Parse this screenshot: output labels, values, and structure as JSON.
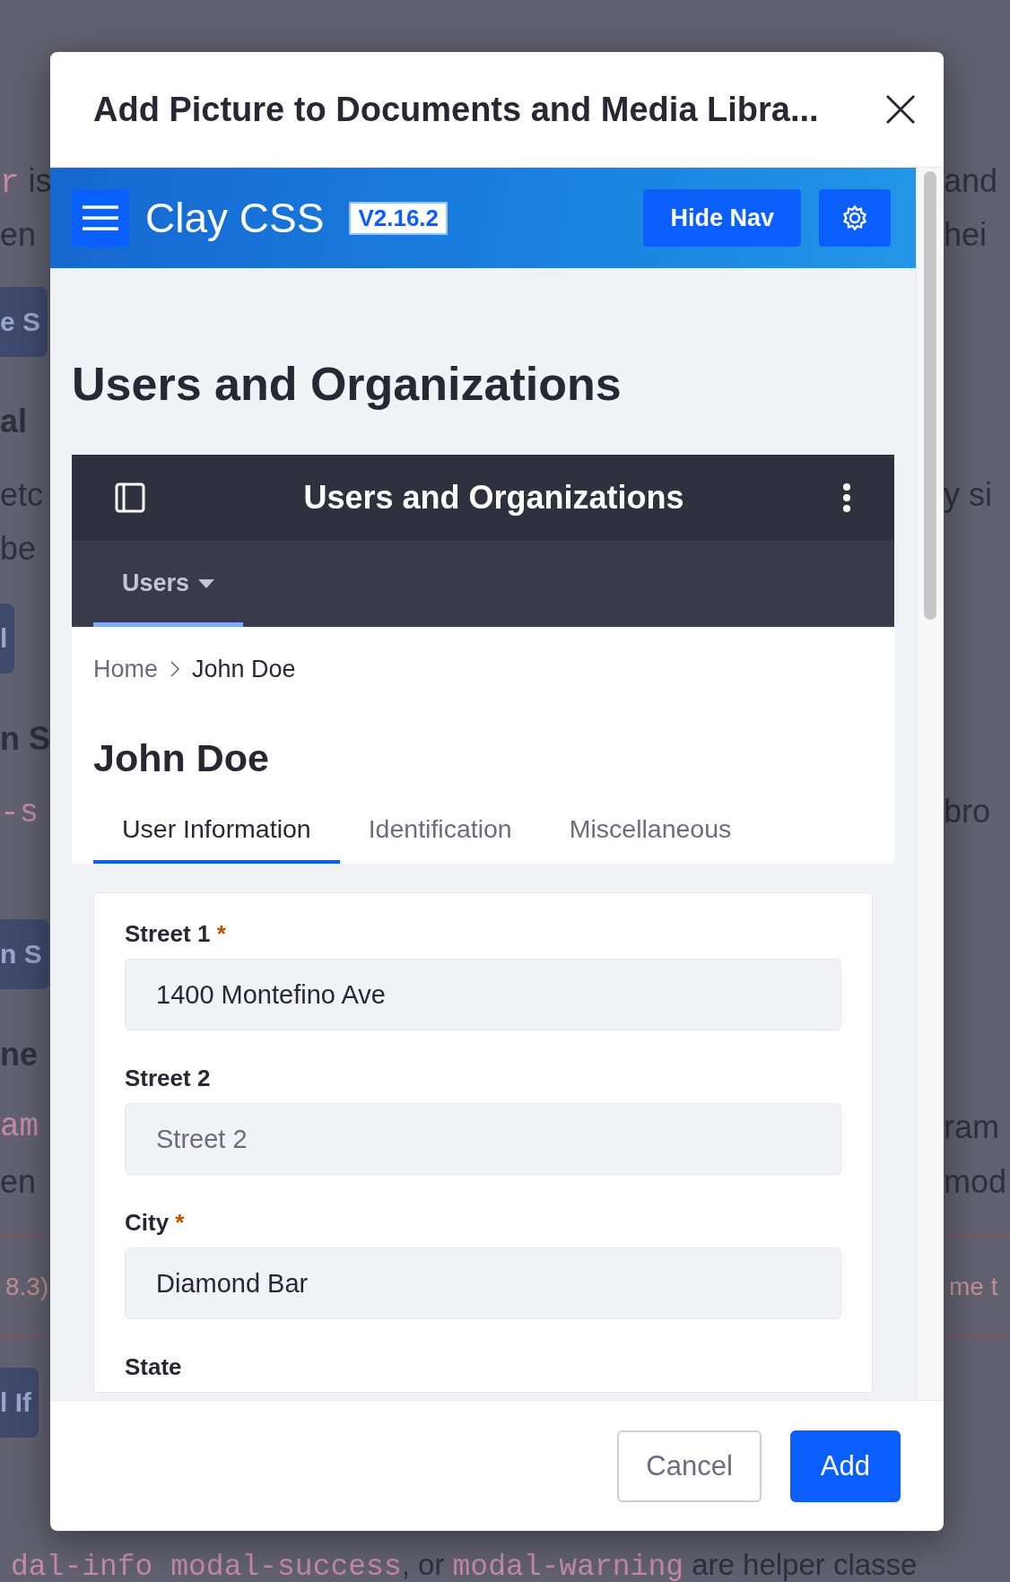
{
  "background": {
    "left": [
      {
        "kind": "text",
        "parts": [
          {
            "kind": "code",
            "text": "r"
          },
          {
            "kind": "text",
            "text": " is"
          }
        ]
      },
      {
        "kind": "text",
        "text": "en"
      },
      {
        "kind": "button",
        "text": "e S"
      },
      {
        "kind": "bold",
        "text": "al"
      },
      {
        "kind": "text",
        "text": "etc"
      },
      {
        "kind": "text",
        "text": " be"
      },
      {
        "kind": "button",
        "text": "l"
      },
      {
        "kind": "bold",
        "text": "n S"
      },
      {
        "kind": "code",
        "text": "-s"
      },
      {
        "kind": "button",
        "text": "n S"
      },
      {
        "kind": "bold",
        "text": "ne"
      },
      {
        "kind": "code",
        "text": "am"
      },
      {
        "kind": "text",
        "text": "en"
      },
      {
        "kind": "rule",
        "text": "8.3)"
      },
      {
        "kind": "button",
        "text": "l If"
      }
    ],
    "right": [
      {
        "kind": "text",
        "text": "and"
      },
      {
        "kind": "text",
        "text": "hei"
      },
      {
        "kind": "text",
        "text": "y si"
      },
      {
        "kind": "text",
        "text": "bro"
      },
      {
        "kind": "text",
        "text": "ram"
      },
      {
        "kind": "text",
        "text": "mod"
      },
      {
        "kind": "rule",
        "text": "me t"
      }
    ],
    "footer_line": [
      {
        "kind": "code",
        "text": "dal-info"
      },
      {
        "kind": "code",
        "text": " modal-success"
      },
      {
        "kind": "text",
        "text": ", or "
      },
      {
        "kind": "code",
        "text": "modal-warning"
      },
      {
        "kind": "text",
        "text": " are helper classe"
      }
    ]
  },
  "modal": {
    "title": "Add Picture to Documents and Media Libra...",
    "app_bar": {
      "brand": "Clay CSS",
      "version": "V2.16.2",
      "hide_nav": "Hide Nav"
    },
    "page_title": "Users and Organizations",
    "panel": {
      "title": "Users and Organizations",
      "nav": [
        {
          "label": "Users",
          "selected": true
        }
      ]
    },
    "breadcrumb": [
      {
        "label": "Home",
        "current": false
      },
      {
        "label": "John Doe",
        "current": true
      }
    ],
    "heading": "John Doe",
    "tabs": [
      {
        "label": "User Information",
        "selected": true
      },
      {
        "label": "Identification",
        "selected": false
      },
      {
        "label": "Miscellaneous",
        "selected": false
      }
    ],
    "fields": [
      {
        "label": "Street 1",
        "required_mark": "*",
        "value": "1400 Montefino Ave"
      },
      {
        "label": "Street 2",
        "placeholder": "Street 2"
      },
      {
        "label": "City",
        "required_mark": "*",
        "value": "Diamond Bar"
      },
      {
        "label": "State"
      }
    ],
    "buttons": [
      {
        "label": "Cancel",
        "kind": "secondary"
      },
      {
        "label": "Add",
        "kind": "primary"
      }
    ]
  }
}
